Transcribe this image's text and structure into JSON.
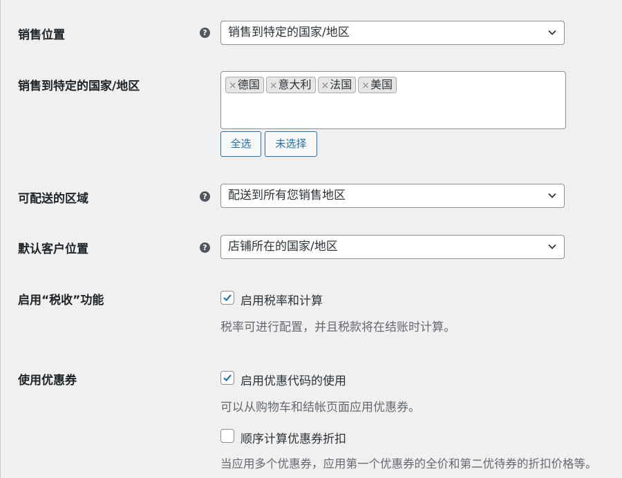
{
  "fields": {
    "sell_location": {
      "label": "销售位置",
      "value": "销售到特定的国家/地区"
    },
    "specific_countries": {
      "label": "销售到特定的国家/地区",
      "countries": [
        "德国",
        "意大利",
        "法国",
        "美国"
      ],
      "remove_symbol": "×",
      "select_all_label": "全选",
      "select_none_label": "未选择"
    },
    "ship_to": {
      "label": "可配送的区域",
      "value": "配送到所有您销售地区"
    },
    "default_customer_location": {
      "label": "默认客户位置",
      "value": "店铺所在的国家/地区"
    },
    "taxes": {
      "label": "启用“税收”功能",
      "checkbox_label": "启用税率和计算",
      "checked": true,
      "description": "税率可进行配置，并且税款将在结账时计算。"
    },
    "coupons": {
      "label": "使用优惠券",
      "checkbox_label": "启用优惠代码的使用",
      "checked": true,
      "description": "可以从购物车和结帐页面应用优惠券。",
      "sequential_label": "顺序计算优惠券折扣",
      "sequential_checked": false,
      "sequential_description": "当应用多个优惠券，应用第一个优惠券的全价和第二优待券的折扣价格等。"
    }
  },
  "icons": {
    "help": "?",
    "help_color": "#50575e",
    "accent": "#2271b1",
    "checkmark_color": "#2271b1"
  }
}
